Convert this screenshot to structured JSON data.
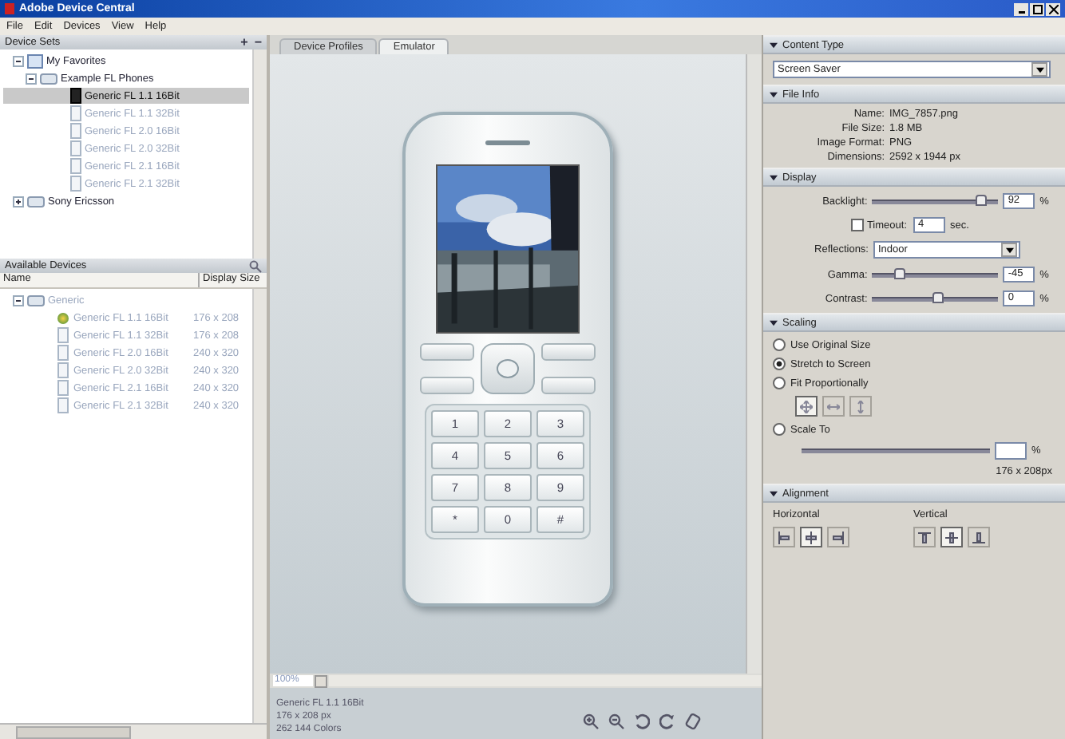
{
  "window": {
    "title": "Adobe Device Central"
  },
  "menu": [
    "File",
    "Edit",
    "Devices",
    "View",
    "Help"
  ],
  "device_sets": {
    "title": "Device Sets",
    "add": "+",
    "remove": "−",
    "tree": [
      {
        "label": "My Favorites",
        "kind": "favorites",
        "expanded": true,
        "children": [
          {
            "label": "Example FL Phones",
            "expanded": true,
            "children": [
              {
                "label": "Generic FL 1.1 16Bit",
                "selected": true
              },
              {
                "label": "Generic FL 1.1 32Bit",
                "selected": false
              },
              {
                "label": "Generic FL 2.0 16Bit",
                "selected": false
              },
              {
                "label": "Generic FL 2.0 32Bit",
                "selected": false
              },
              {
                "label": "Generic FL 2.1 16Bit",
                "selected": false
              },
              {
                "label": "Generic FL 2.1 32Bit",
                "selected": false
              }
            ]
          }
        ]
      },
      {
        "label": "Sony Ericsson",
        "kind": "group",
        "expanded": false
      }
    ]
  },
  "available_devices": {
    "title": "Available Devices",
    "columns": [
      "Name",
      "Display Size"
    ],
    "group": {
      "label": "Generic",
      "expanded": true
    },
    "rows": [
      {
        "name": "Generic FL 1.1 16Bit",
        "size": "176 x 208",
        "selected": false,
        "kind": "active"
      },
      {
        "name": "Generic FL 1.1 32Bit",
        "size": "176 x 208",
        "selected": false,
        "kind": "device"
      },
      {
        "name": "Generic FL 2.0 16Bit",
        "size": "240 x 320",
        "selected": false,
        "kind": "device"
      },
      {
        "name": "Generic FL 2.0 32Bit",
        "size": "240 x 320",
        "selected": false,
        "kind": "device"
      },
      {
        "name": "Generic FL 2.1 16Bit",
        "size": "240 x 320",
        "selected": false,
        "kind": "device"
      },
      {
        "name": "Generic FL 2.1 32Bit",
        "size": "240 x 320",
        "selected": false,
        "kind": "device"
      }
    ]
  },
  "tabs": [
    {
      "label": "Device Profiles",
      "selected": false
    },
    {
      "label": "Emulator",
      "selected": true
    }
  ],
  "keypad": [
    "1",
    "2",
    "3",
    "4",
    "5",
    "6",
    "7",
    "8",
    "9",
    "*",
    "0",
    "#"
  ],
  "zoom": "100%",
  "status": [
    "Generic FL 1.1 16Bit",
    "176 x 208 px",
    "262 144 Colors"
  ],
  "content_type": {
    "title": "Content Type",
    "value": "Screen Saver"
  },
  "file_info": {
    "title": "File Info",
    "rows": [
      {
        "label": "Name:",
        "value": "IMG_7857.png"
      },
      {
        "label": "File Size:",
        "value": "1.8 MB"
      },
      {
        "label": "Image Format:",
        "value": "PNG"
      },
      {
        "label": "Dimensions:",
        "value": "2592 x 1944 px"
      }
    ]
  },
  "display": {
    "title": "Display",
    "backlight": {
      "label": "Backlight:",
      "level": 0.85,
      "value": "92",
      "unit": "%"
    },
    "timeout": {
      "label": "Timeout:",
      "checked": false,
      "value": "4",
      "unit": "sec."
    },
    "reflections": {
      "label": "Reflections:",
      "value": "Indoor"
    },
    "gamma": {
      "label": "Gamma:",
      "level": 0.2,
      "value": "-45",
      "unit": "%"
    },
    "contrast": {
      "label": "Contrast:",
      "level": 0.5,
      "value": "0",
      "unit": "%"
    }
  },
  "scaling": {
    "title": "Scaling",
    "options": [
      {
        "label": "Use Original Size",
        "selected": false
      },
      {
        "label": "Stretch to Screen",
        "selected": true
      },
      {
        "label": "Fit Proportionally",
        "selected": false
      }
    ],
    "fit_modes": [
      {
        "kind": "both",
        "selected": true
      },
      {
        "kind": "horizontal",
        "selected": false
      },
      {
        "kind": "vertical",
        "selected": false
      }
    ],
    "scale_to": {
      "label": "Scale To",
      "selected": false,
      "unit": "%"
    },
    "size": "176 x 208px"
  },
  "alignment": {
    "title": "Alignment",
    "horizontal": {
      "label": "Horizontal",
      "buttons": [
        {
          "kind": "left",
          "selected": false
        },
        {
          "kind": "center",
          "selected": true
        },
        {
          "kind": "right",
          "selected": false
        }
      ]
    },
    "vertical": {
      "label": "Vertical",
      "buttons": [
        {
          "kind": "top",
          "selected": false
        },
        {
          "kind": "middle",
          "selected": true
        },
        {
          "kind": "bottom",
          "selected": false
        }
      ]
    }
  }
}
